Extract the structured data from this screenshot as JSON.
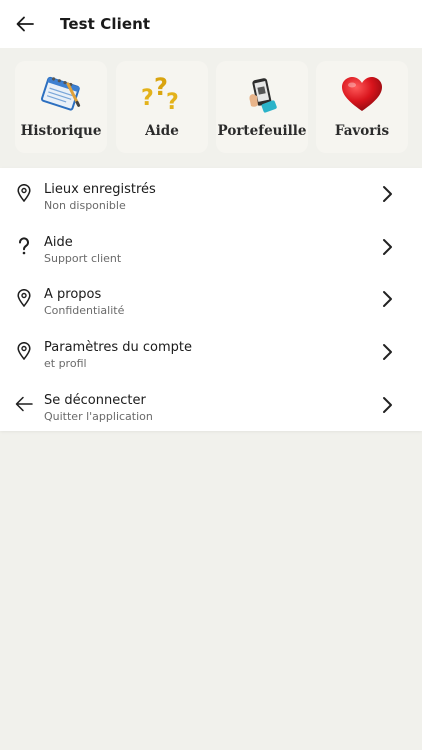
{
  "header": {
    "title": "Test Client",
    "back_icon": "arrow-left-icon"
  },
  "quick_links": [
    {
      "label": "Historique",
      "icon": "notepad-icon"
    },
    {
      "label": "Aide",
      "icon": "question-marks-icon"
    },
    {
      "label": "Portefeuille",
      "icon": "phone-wallet-icon"
    },
    {
      "label": "Favoris",
      "icon": "heart-icon"
    }
  ],
  "menu": [
    {
      "title": "Lieux enregistrés",
      "subtitle": "Non disponible",
      "icon": "location-pin-icon"
    },
    {
      "title": "Aide",
      "subtitle": "Support client",
      "icon": "question-mark-icon"
    },
    {
      "title": "A propos",
      "subtitle": "Confidentialité",
      "icon": "location-pin-icon"
    },
    {
      "title": "Paramètres du compte",
      "subtitle": "et profil",
      "icon": "location-pin-icon"
    },
    {
      "title": "Se déconnecter",
      "subtitle": "Quitter l'application",
      "icon": "arrow-left-icon"
    }
  ],
  "colors": {
    "page_bg": "#f1f1ec",
    "card_bg": "#ffffff",
    "heart": "#d8141c",
    "question": "#e3b21a"
  }
}
